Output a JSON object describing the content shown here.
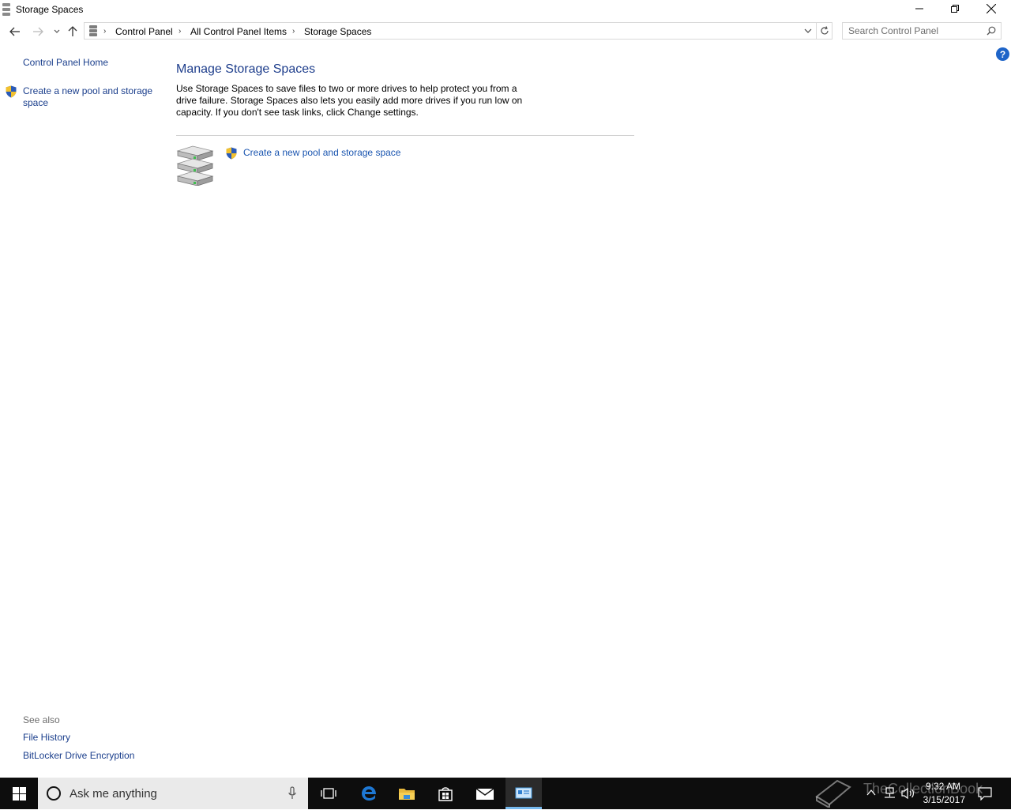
{
  "window": {
    "title": "Storage Spaces"
  },
  "address": {
    "crumbs": [
      "Control Panel",
      "All Control Panel Items",
      "Storage Spaces"
    ],
    "search_placeholder": "Search Control Panel"
  },
  "left_pane": {
    "home": "Control Panel Home",
    "task": "Create a new pool and storage space",
    "see_also_header": "See also",
    "see_also": [
      "File History",
      "BitLocker Drive Encryption"
    ]
  },
  "main": {
    "title": "Manage Storage Spaces",
    "description": "Use Storage Spaces to save files to two or more drives to help protect you from a drive failure. Storage Spaces also lets you easily add more drives if you run low on capacity. If you don't see task links, click Change settings.",
    "task": "Create a new pool and storage space"
  },
  "help": {
    "label": "?"
  },
  "taskbar": {
    "search_placeholder": "Ask me anything",
    "time": "9:32 AM",
    "date": "3/15/2017",
    "watermark": "TheCollectionBook"
  },
  "colors": {
    "link": "#1a3e8c",
    "title": "#1e3e8c",
    "taskbar": "#0d0d0d",
    "active_indicator": "#76b9ed"
  }
}
